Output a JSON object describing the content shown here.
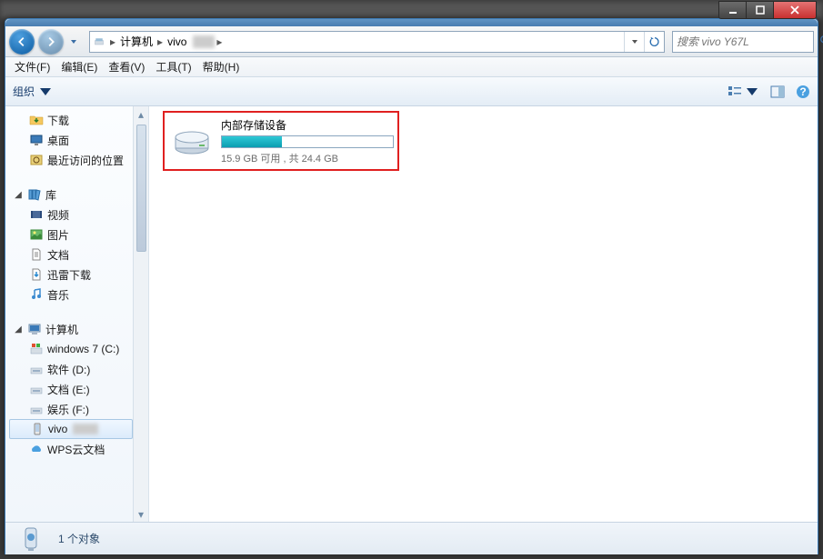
{
  "breadcrumb": {
    "item1": "计算机",
    "item2": "vivo"
  },
  "search": {
    "placeholder": "搜索 vivo Y67L"
  },
  "menubar": {
    "file": "文件(F)",
    "edit": "编辑(E)",
    "view": "查看(V)",
    "tools": "工具(T)",
    "help": "帮助(H)"
  },
  "toolbar": {
    "organize": "组织"
  },
  "sidebar": {
    "downloads": "下载",
    "desktop": "桌面",
    "recent": "最近访问的位置",
    "libraries": "库",
    "videos": "视频",
    "pictures": "图片",
    "documents": "文档",
    "xunlei": "迅雷下载",
    "music": "音乐",
    "computer": "计算机",
    "drive_c": "windows 7 (C:)",
    "drive_d": "软件 (D:)",
    "drive_e": "文档 (E:)",
    "drive_f": "娱乐 (F:)",
    "vivo": "vivo",
    "wps": "WPS云文档"
  },
  "device": {
    "title": "内部存储设备",
    "subtitle": "15.9 GB 可用 , 共 24.4 GB",
    "used_percent": 35
  },
  "status": {
    "text": "1 个对象"
  }
}
